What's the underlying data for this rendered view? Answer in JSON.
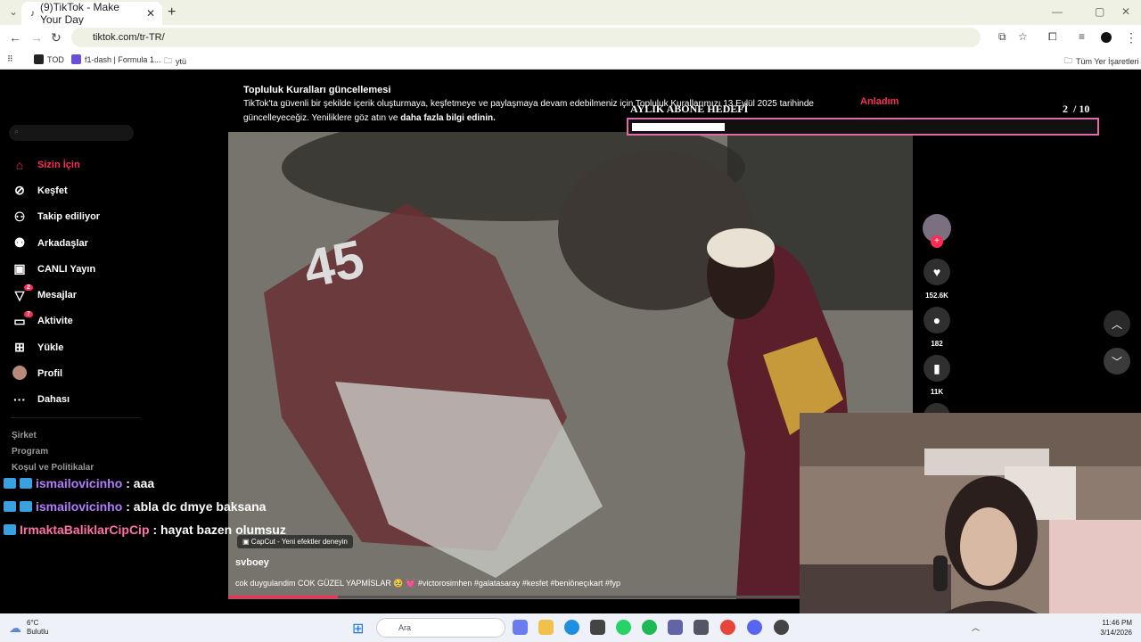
{
  "browser": {
    "tab_title": "(9)TikTok - Make Your Day",
    "url": "tiktok.com/tr-TR/",
    "bookmarks": [
      "TOD",
      "f1-dash | Formula 1...",
      "ytü"
    ],
    "all_bookmarks": "Tüm Yer İşaretleri"
  },
  "banner": {
    "title": "Topluluk Kuralları güncellemesi",
    "text": "TikTok'ta güvenli bir şekilde içerik oluşturmaya, keşfetmeye ve paylaşmaya devam edebilmeniz için Topluluk Kurallarımızı 13 Eylül 2025 tarihinde güncelleyeceğiz. Yeniliklere göz atın ve",
    "link": "daha fazla bilgi edinin.",
    "button": "Anladım"
  },
  "sidebar": {
    "items": [
      {
        "label": "Sizin İçin",
        "icon": "home-icon"
      },
      {
        "label": "Keşfet",
        "icon": "compass-icon"
      },
      {
        "label": "Takip ediliyor",
        "icon": "following-icon"
      },
      {
        "label": "Arkadaşlar",
        "icon": "friends-icon"
      },
      {
        "label": "CANLI Yayın",
        "icon": "live-icon"
      },
      {
        "label": "Mesajlar",
        "icon": "messages-icon",
        "badge": "2"
      },
      {
        "label": "Aktivite",
        "icon": "activity-icon",
        "badge": "7"
      },
      {
        "label": "Yükle",
        "icon": "upload-icon"
      },
      {
        "label": "Profil",
        "icon": "profile-avatar-icon"
      },
      {
        "label": "Dahası",
        "icon": "more-icon"
      }
    ],
    "footer": [
      "Şirket",
      "Program",
      "Koşul ve Politikalar"
    ]
  },
  "video": {
    "capcut_label": "CapCut - Yeni efektler deneyin",
    "author": "svboey",
    "caption": "cok duygulandim COK GÜZEL YAPMİSLAR 🥹 💓 #victorosimhen #galatasaray #kesfet #beniöneçıkart #fyp",
    "progress": 0.16
  },
  "actions": {
    "likes": "152.6K",
    "comments": "182",
    "saves": "11K"
  },
  "overlay": {
    "goal_title": "AYLIK ABONE HEDEFİ",
    "goal_current": "2",
    "goal_total": "/ 10",
    "goal_progress": 0.2,
    "chat": [
      {
        "user": "ismailovicinho",
        "msg": ": aaa",
        "color": "#b47cff"
      },
      {
        "user": "ismailovicinho",
        "msg": ": abla dc dmye baksana",
        "color": "#b47cff"
      },
      {
        "user": "IrmaktaBaliklarCipCip",
        "msg": ": hayat bazen olumsuz",
        "color": "#ff6fa8"
      }
    ]
  },
  "taskbar": {
    "temp": "6°C",
    "weather": "Bulutlu",
    "search": "Ara",
    "time": "11:46 PM",
    "date": "3/14/2026"
  },
  "colors": {
    "accent": "#fe2c55",
    "goal_border": "#e26aa9"
  }
}
